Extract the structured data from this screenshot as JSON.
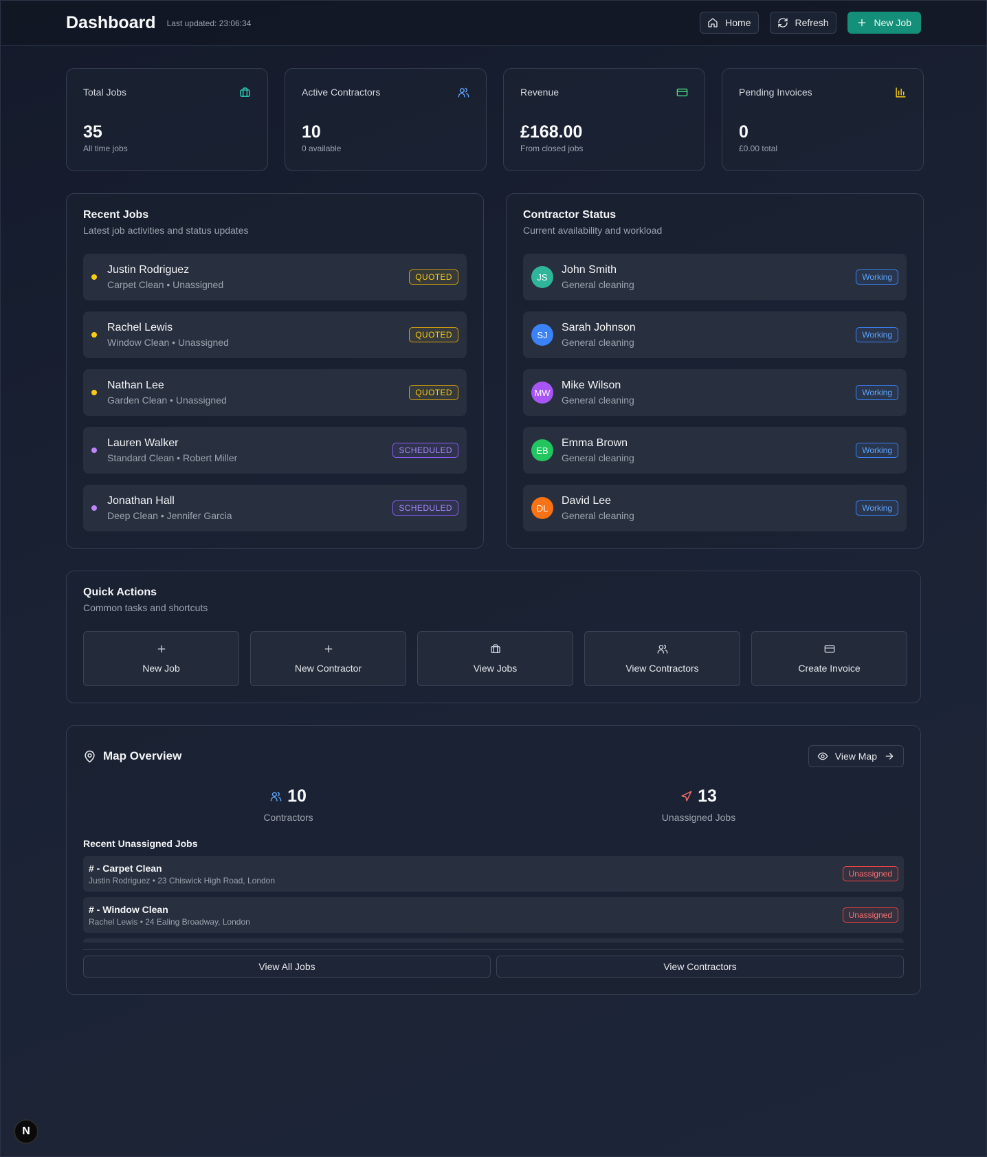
{
  "header": {
    "title": "Dashboard",
    "last_updated": "Last updated: 23:06:34",
    "home": "Home",
    "refresh": "Refresh",
    "new_job": "New Job"
  },
  "stats": [
    {
      "label": "Total Jobs",
      "value": "35",
      "sub": "All time jobs",
      "icon": "briefcase-icon",
      "color": "#2dd4bf"
    },
    {
      "label": "Active Contractors",
      "value": "10",
      "sub": "0 available",
      "icon": "users-icon",
      "color": "#60a5fa"
    },
    {
      "label": "Revenue",
      "value": "£168.00",
      "sub": "From closed jobs",
      "icon": "credit-card-icon",
      "color": "#4ade80"
    },
    {
      "label": "Pending Invoices",
      "value": "0",
      "sub": "£0.00 total",
      "icon": "bar-chart-icon",
      "color": "#facc15"
    }
  ],
  "recent_jobs": {
    "title": "Recent Jobs",
    "subtitle": "Latest job activities and status updates",
    "items": [
      {
        "name": "Justin Rodriguez",
        "meta": "Carpet Clean • Unassigned",
        "status": "QUOTED",
        "dot": "#facc15"
      },
      {
        "name": "Rachel Lewis",
        "meta": "Window Clean • Unassigned",
        "status": "QUOTED",
        "dot": "#facc15"
      },
      {
        "name": "Nathan Lee",
        "meta": "Garden Clean • Unassigned",
        "status": "QUOTED",
        "dot": "#facc15"
      },
      {
        "name": "Lauren Walker",
        "meta": "Standard Clean • Robert Miller",
        "status": "SCHEDULED",
        "dot": "#c084fc"
      },
      {
        "name": "Jonathan Hall",
        "meta": "Deep Clean • Jennifer Garcia",
        "status": "SCHEDULED",
        "dot": "#c084fc"
      }
    ]
  },
  "contractor_status": {
    "title": "Contractor Status",
    "subtitle": "Current availability and workload",
    "items": [
      {
        "initials": "JS",
        "name": "John Smith",
        "meta": "General cleaning",
        "status": "Working",
        "color": "#2fb59a"
      },
      {
        "initials": "SJ",
        "name": "Sarah Johnson",
        "meta": "General cleaning",
        "status": "Working",
        "color": "#3b82f6"
      },
      {
        "initials": "MW",
        "name": "Mike Wilson",
        "meta": "General cleaning",
        "status": "Working",
        "color": "#a855f7"
      },
      {
        "initials": "EB",
        "name": "Emma Brown",
        "meta": "General cleaning",
        "status": "Working",
        "color": "#22c55e"
      },
      {
        "initials": "DL",
        "name": "David Lee",
        "meta": "General cleaning",
        "status": "Working",
        "color": "#f97316"
      }
    ]
  },
  "quick_actions": {
    "title": "Quick Actions",
    "subtitle": "Common tasks and shortcuts",
    "items": [
      {
        "label": "New Job",
        "icon": "plus-icon"
      },
      {
        "label": "New Contractor",
        "icon": "plus-icon"
      },
      {
        "label": "View Jobs",
        "icon": "briefcase-icon"
      },
      {
        "label": "View Contractors",
        "icon": "users-icon"
      },
      {
        "label": "Create Invoice",
        "icon": "credit-card-icon"
      }
    ]
  },
  "map_overview": {
    "title": "Map Overview",
    "view_map": "View Map",
    "contractors_value": "10",
    "contractors_label": "Contractors",
    "unassigned_value": "13",
    "unassigned_label": "Unassigned Jobs",
    "recent_title": "Recent Unassigned Jobs",
    "jobs": [
      {
        "name": "# - Carpet Clean",
        "meta": "Justin Rodriguez • 23 Chiswick High Road, London",
        "status": "Unassigned"
      },
      {
        "name": "# - Window Clean",
        "meta": "Rachel Lewis • 24 Ealing Broadway, London",
        "status": "Unassigned"
      }
    ],
    "view_all_jobs": "View All Jobs",
    "view_contractors": "View Contractors"
  },
  "dev_badge": "N"
}
